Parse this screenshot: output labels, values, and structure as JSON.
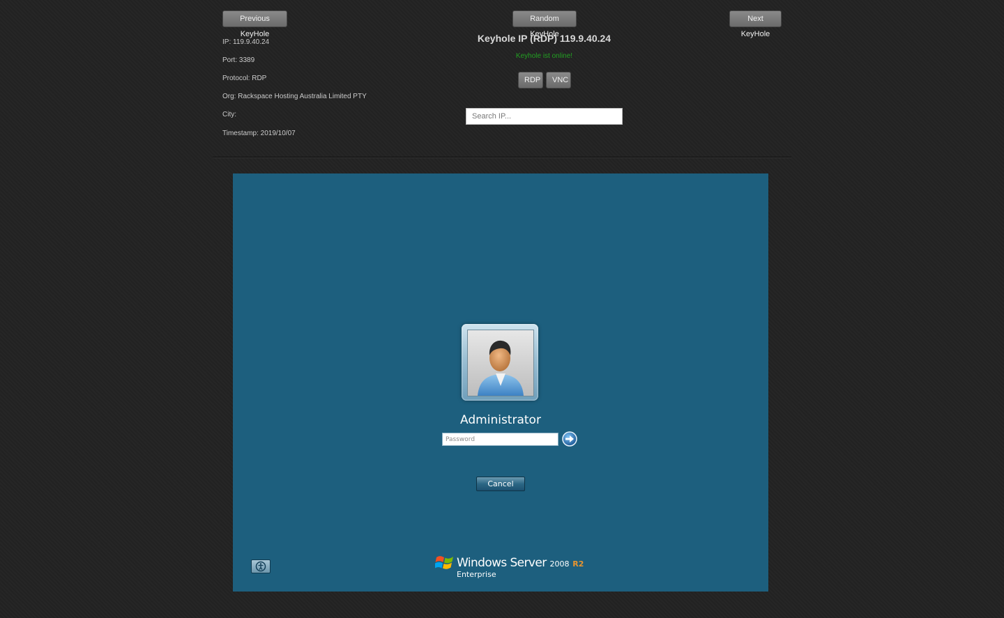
{
  "nav": {
    "previous_label": "Previous KeyHole",
    "random_label": "Random KeyHole",
    "next_label": "Next KeyHole"
  },
  "info": {
    "ip": "IP: 119.9.40.24",
    "port": "Port: 3389",
    "protocol": "Protocol: RDP",
    "org": "Org: Rackspace Hosting Australia Limited PTY",
    "city": "City:",
    "timestamp": "Timestamp: 2019/10/07"
  },
  "header": {
    "title": "Keyhole IP (RDP) 119.9.40.24",
    "status": "Keyhole ist online!",
    "status_color": "#22a022"
  },
  "protocols": {
    "rdp_label": "RDP",
    "vnc_label": "VNC"
  },
  "search": {
    "placeholder": "Search IP..."
  },
  "remote_screen": {
    "background_color": "#1d5f7e",
    "username": "Administrator",
    "password_placeholder": "Password",
    "cancel_label": "Cancel",
    "submit_icon": "arrow-right-icon",
    "ease_of_access_icon": "ease-of-access-icon",
    "logo": {
      "brand": "Windows Server",
      "version": "2008",
      "release": "R2",
      "edition": "Enterprise"
    }
  }
}
